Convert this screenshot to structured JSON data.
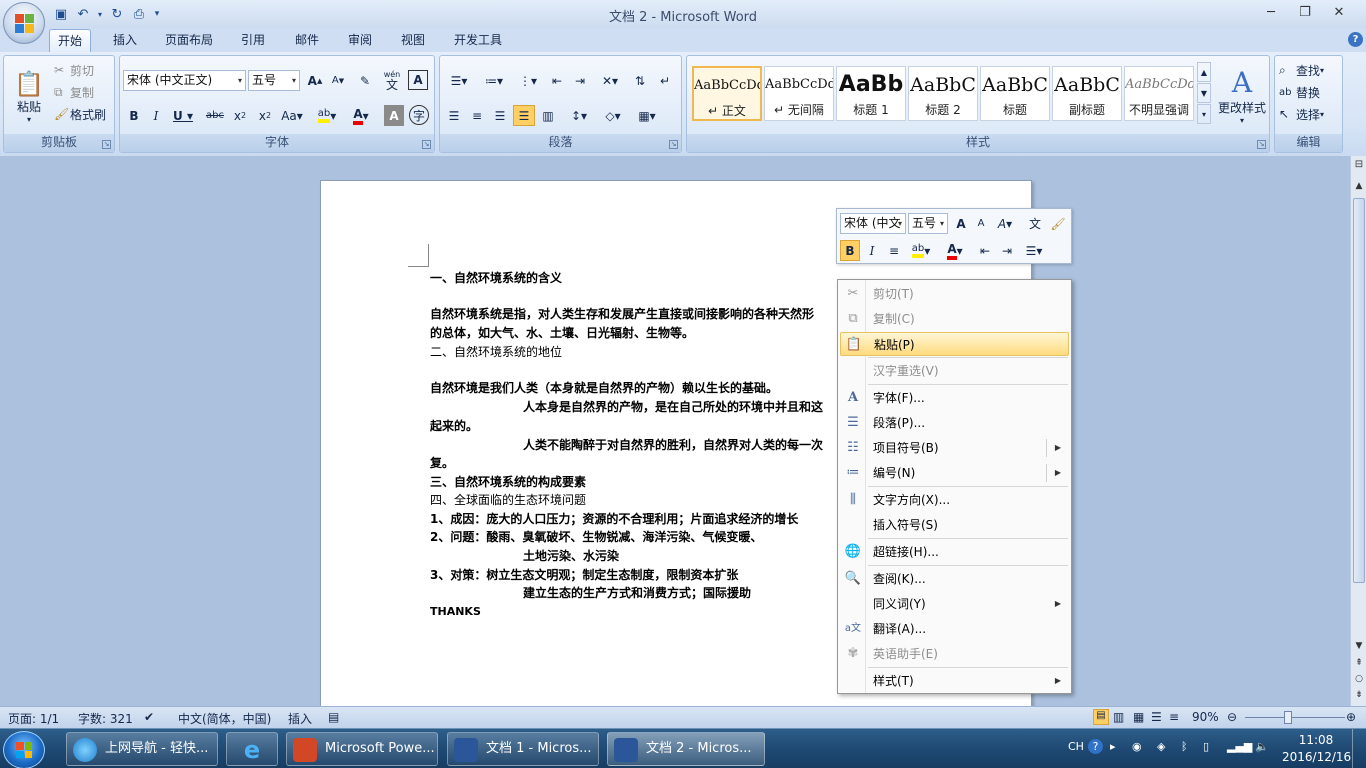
{
  "window": {
    "title": "文档 2 - Microsoft Word"
  },
  "ribbon_tabs": [
    "开始",
    "插入",
    "页面布局",
    "引用",
    "邮件",
    "审阅",
    "视图",
    "开发工具"
  ],
  "clipboard": {
    "paste": "粘贴",
    "cut": "剪切",
    "copy": "复制",
    "format_painter": "格式刷",
    "label": "剪贴板"
  },
  "font": {
    "name": "宋体 (中文正文)",
    "size": "五号",
    "label": "字体",
    "wen": "wén"
  },
  "paragraph": {
    "label": "段落"
  },
  "styles": {
    "label": "样式",
    "change_styles": "更改样式",
    "items": [
      {
        "preview": "AaBbCcDd",
        "name": "正文"
      },
      {
        "preview": "AaBbCcDd",
        "name": "无间隔"
      },
      {
        "preview": "AaBb",
        "name": "标题 1"
      },
      {
        "preview": "AaBbC",
        "name": "标题 2"
      },
      {
        "preview": "AaBbC",
        "name": "标题"
      },
      {
        "preview": "AaBbC",
        "name": "副标题"
      },
      {
        "preview": "AaBbCcDd",
        "name": "不明显强调"
      }
    ]
  },
  "editing": {
    "find": "查找",
    "replace": "替换",
    "select": "选择",
    "label": "编辑"
  },
  "document": {
    "lines": [
      {
        "text": "一、自然环境系统的含义",
        "bold": true
      },
      {
        "text": "自然环境系统是指，对人类生存和发展产生直接或间接影响的各种天然形",
        "bold": true
      },
      {
        "text": "的总体，如大气、水、土壤、日光辐射、生物等。",
        "bold": true
      },
      {
        "text": "二、自然环境系统的地位",
        "bold": false
      },
      {
        "text": "自然环境是我们人类（本身就是自然界的产物）赖以生长的基础。",
        "bold": true
      },
      {
        "text": "人本身是自然界的产物，是在自己所处的环境中并且和这",
        "bold": true
      },
      {
        "text": "起来的。",
        "bold": true
      },
      {
        "text": "人类不能陶醉于对自然界的胜利，自然界对人类的每一次",
        "bold": true
      },
      {
        "text": "复。",
        "bold": true
      },
      {
        "text": "三、自然环境系统的构成要素",
        "bold": true
      },
      {
        "text": "四、全球面临的生态环境问题",
        "bold": false
      },
      {
        "text": "1、成因：庞大的人口压力；资源的不合理利用；片面追求经济的增长",
        "bold": true
      },
      {
        "text": "2、问题：酸雨、臭氧破坏、生物锐减、海洋污染、气候变暖、",
        "bold": true
      },
      {
        "text": "土地污染、水污染",
        "bold": true
      },
      {
        "text": "3、对策：树立生态文明观；制定生态制度，限制资本扩张",
        "bold": true
      },
      {
        "text": "建立生态的生产方式和消费方式；国际援助",
        "bold": true
      },
      {
        "text": "THANKS",
        "bold": true
      }
    ]
  },
  "mini_toolbar": {
    "font": "宋体 (中文",
    "size": "五号"
  },
  "context_menu": [
    {
      "label": "剪切(T)",
      "icon": "scissors-icon",
      "disabled": true
    },
    {
      "label": "复制(C)",
      "icon": "copy-icon",
      "disabled": true
    },
    {
      "label": "粘贴(P)",
      "icon": "paste-icon",
      "disabled": false,
      "highlighted": true
    },
    {
      "label": "汉字重选(V)",
      "icon": "",
      "disabled": true
    },
    {
      "label": "字体(F)...",
      "icon": "font-icon",
      "disabled": false
    },
    {
      "label": "段落(P)...",
      "icon": "paragraph-icon",
      "disabled": false
    },
    {
      "label": "项目符号(B)",
      "icon": "bullets-icon",
      "disabled": false,
      "submenu": true
    },
    {
      "label": "编号(N)",
      "icon": "numbering-icon",
      "disabled": false,
      "submenu": true
    },
    {
      "label": "文字方向(X)...",
      "icon": "text-direction-icon",
      "disabled": false
    },
    {
      "label": "插入符号(S)",
      "icon": "",
      "disabled": false
    },
    {
      "label": "超链接(H)...",
      "icon": "hyperlink-icon",
      "disabled": false
    },
    {
      "label": "查阅(K)...",
      "icon": "research-icon",
      "disabled": false
    },
    {
      "label": "同义词(Y)",
      "icon": "",
      "disabled": false,
      "submenu": true
    },
    {
      "label": "翻译(A)...",
      "icon": "translate-icon",
      "disabled": false
    },
    {
      "label": "英语助手(E)",
      "icon": "english-assistant-icon",
      "disabled": true
    },
    {
      "label": "样式(T)",
      "icon": "",
      "disabled": false,
      "submenu": true
    }
  ],
  "status": {
    "page": "页面: 1/1",
    "words": "字数: 321",
    "language": "中文(简体，中国)",
    "mode": "插入",
    "zoom": "90%"
  },
  "taskbar": {
    "items": [
      "上网导航 - 轻快...",
      "Microsoft Powe...",
      "文档 1 - Micros...",
      "文档 2 - Micros..."
    ],
    "lang": "CH",
    "time": "11:08",
    "date": "2016/12/16"
  }
}
